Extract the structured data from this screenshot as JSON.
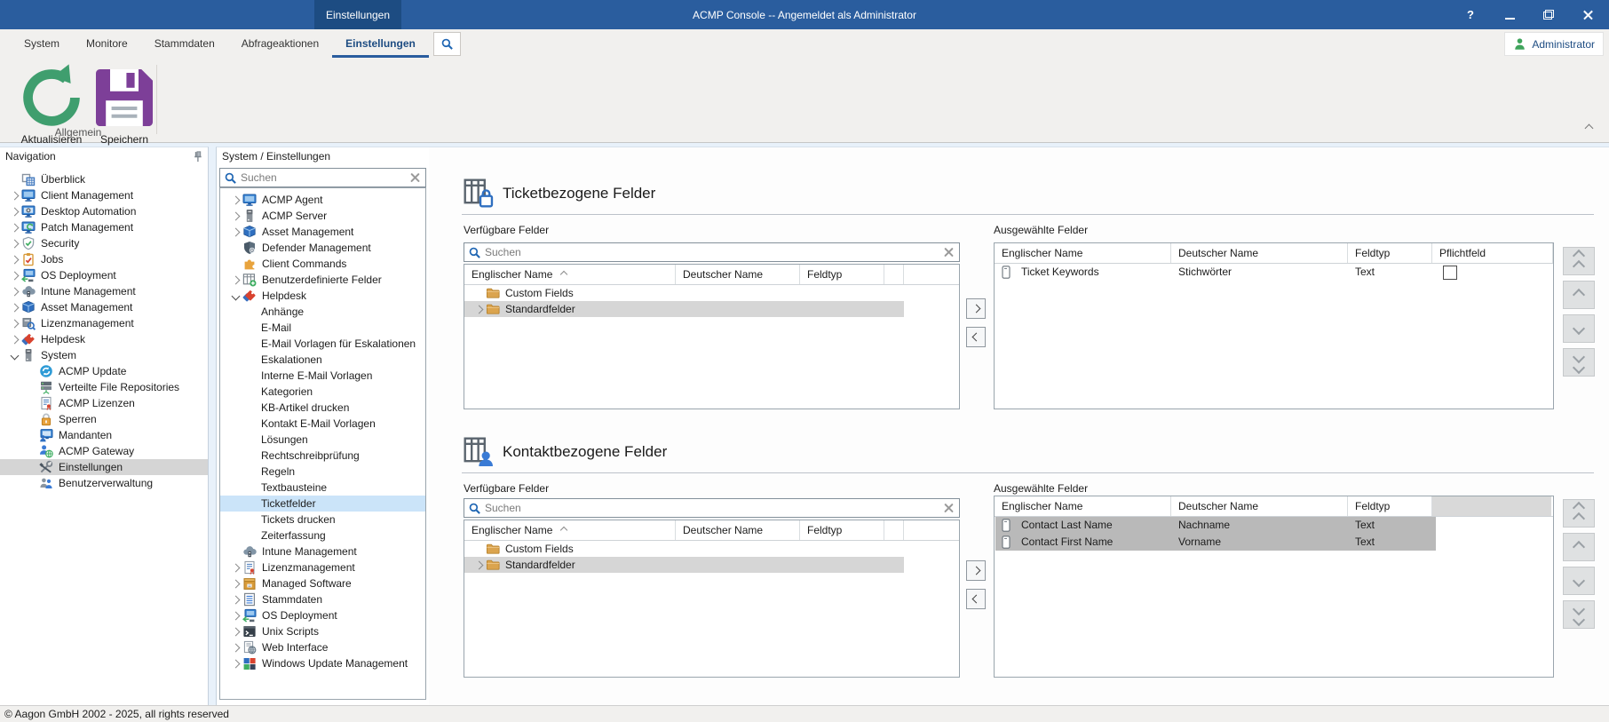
{
  "colors": {
    "titlebar_blue": "#2a5d9e",
    "titlebar_tab_blue": "#1d4c82",
    "accent_blue": "#2a5d9e",
    "tree_selection_blue": "#cbe4f9",
    "tree_selection_gray": "#d5d5d5",
    "row_selection_gray": "#b9b9b9",
    "folder_amber": "#dba44e",
    "refresh_green": "#3f9e6e",
    "save_purple": "#7d3f98",
    "admin_green": "#3fa45c"
  },
  "titlebar": {
    "context_tab": "Einstellungen",
    "title": "ACMP Console -- Angemeldet als Administrator",
    "help_glyph": "?"
  },
  "menubar": {
    "tabs": [
      "System",
      "Monitore",
      "Stammdaten",
      "Abfrageaktionen",
      "Einstellungen"
    ],
    "active_tab": "Einstellungen"
  },
  "ribbon": {
    "buttons": [
      {
        "label": "Aktualisieren",
        "icon": "refresh"
      },
      {
        "label": "Speichern",
        "icon": "save"
      }
    ],
    "group_label": "Allgemein"
  },
  "user_badge": {
    "label": "Administrator"
  },
  "nav_panel": {
    "header": "Navigation",
    "items": [
      {
        "label": "Überblick",
        "icon": "overview",
        "chevron": "none",
        "level": 0
      },
      {
        "label": "Client Management",
        "icon": "monitor",
        "chevron": "right",
        "level": 0
      },
      {
        "label": "Desktop Automation",
        "icon": "monitor-gear",
        "chevron": "right",
        "level": 0
      },
      {
        "label": "Patch Management",
        "icon": "monitor-refresh",
        "chevron": "right",
        "level": 0
      },
      {
        "label": "Security",
        "icon": "shield-check",
        "chevron": "right",
        "level": 0
      },
      {
        "label": "Jobs",
        "icon": "jobs",
        "chevron": "right",
        "level": 0
      },
      {
        "label": "OS Deployment",
        "icon": "os-deploy",
        "chevron": "right",
        "level": 0
      },
      {
        "label": "Intune Management",
        "icon": "cloud",
        "chevron": "right",
        "level": 0
      },
      {
        "label": "Asset Management",
        "icon": "package",
        "chevron": "right",
        "level": 0
      },
      {
        "label": "Lizenzmanagement",
        "icon": "license-search",
        "chevron": "right",
        "level": 0
      },
      {
        "label": "Helpdesk",
        "icon": "tag",
        "chevron": "right",
        "level": 0
      },
      {
        "label": "System",
        "icon": "server-tower",
        "chevron": "down",
        "level": 0
      },
      {
        "label": "ACMP Update",
        "icon": "update",
        "chevron": "none",
        "level": 1
      },
      {
        "label": "Verteilte File Repositories",
        "icon": "file-repos",
        "chevron": "none",
        "level": 1
      },
      {
        "label": "ACMP Lizenzen",
        "icon": "doc-seal",
        "chevron": "none",
        "level": 1
      },
      {
        "label": "Sperren",
        "icon": "lock",
        "chevron": "none",
        "level": 1
      },
      {
        "label": "Mandanten",
        "icon": "monitor-person",
        "chevron": "none",
        "level": 1
      },
      {
        "label": "ACMP Gateway",
        "icon": "gateway",
        "chevron": "none",
        "level": 1
      },
      {
        "label": "Einstellungen",
        "icon": "tools",
        "chevron": "none",
        "level": 1,
        "selected": true
      },
      {
        "label": "Benutzerverwaltung",
        "icon": "people",
        "chevron": "none",
        "level": 1
      }
    ]
  },
  "tree_panel": {
    "header": "System / Einstellungen",
    "search_placeholder": "Suchen",
    "items": [
      {
        "label": "ACMP Agent",
        "icon": "monitor",
        "chevron": "right",
        "level": 0
      },
      {
        "label": "ACMP Server",
        "icon": "server-tower",
        "chevron": "right",
        "level": 0
      },
      {
        "label": "Asset Management",
        "icon": "package",
        "chevron": "right",
        "level": 0
      },
      {
        "label": "Defender Management",
        "icon": "defender",
        "chevron": "none",
        "level": 0
      },
      {
        "label": "Client Commands",
        "icon": "puzzle",
        "chevron": "none",
        "level": 0
      },
      {
        "label": "Benutzerdefinierte Felder",
        "icon": "table-plus",
        "chevron": "right",
        "level": 0
      },
      {
        "label": "Helpdesk",
        "icon": "tag",
        "chevron": "down",
        "level": 0
      },
      {
        "label": "Anhänge",
        "icon": null,
        "chevron": "none",
        "level": 1
      },
      {
        "label": "E-Mail",
        "icon": null,
        "chevron": "none",
        "level": 1
      },
      {
        "label": "E-Mail Vorlagen für Eskalationen",
        "icon": null,
        "chevron": "none",
        "level": 1
      },
      {
        "label": "Eskalationen",
        "icon": null,
        "chevron": "none",
        "level": 1
      },
      {
        "label": "Interne E-Mail Vorlagen",
        "icon": null,
        "chevron": "none",
        "level": 1
      },
      {
        "label": "Kategorien",
        "icon": null,
        "chevron": "none",
        "level": 1
      },
      {
        "label": "KB-Artikel drucken",
        "icon": null,
        "chevron": "none",
        "level": 1
      },
      {
        "label": "Kontakt E-Mail Vorlagen",
        "icon": null,
        "chevron": "none",
        "level": 1
      },
      {
        "label": "Lösungen",
        "icon": null,
        "chevron": "none",
        "level": 1
      },
      {
        "label": "Rechtschreibprüfung",
        "icon": null,
        "chevron": "none",
        "level": 1
      },
      {
        "label": "Regeln",
        "icon": null,
        "chevron": "none",
        "level": 1
      },
      {
        "label": "Textbausteine",
        "icon": null,
        "chevron": "none",
        "level": 1
      },
      {
        "label": "Ticketfelder",
        "icon": null,
        "chevron": "none",
        "level": 1,
        "selected": true
      },
      {
        "label": "Tickets drucken",
        "icon": null,
        "chevron": "none",
        "level": 1
      },
      {
        "label": "Zeiterfassung",
        "icon": null,
        "chevron": "none",
        "level": 1
      },
      {
        "label": "Intune Management",
        "icon": "cloud",
        "chevron": "none",
        "level": 0
      },
      {
        "label": "Lizenzmanagement",
        "icon": "doc-seal",
        "chevron": "right",
        "level": 0
      },
      {
        "label": "Managed Software",
        "icon": "managed-box",
        "chevron": "right",
        "level": 0
      },
      {
        "label": "Stammdaten",
        "icon": "list",
        "chevron": "right",
        "level": 0
      },
      {
        "label": "OS Deployment",
        "icon": "os-deploy",
        "chevron": "right",
        "level": 0
      },
      {
        "label": "Unix Scripts",
        "icon": "terminal",
        "chevron": "right",
        "level": 0
      },
      {
        "label": "Web Interface",
        "icon": "web",
        "chevron": "right",
        "level": 0
      },
      {
        "label": "Windows Update Management",
        "icon": "windows",
        "chevron": "right",
        "level": 0
      }
    ]
  },
  "main": {
    "sections": [
      {
        "title": "Ticketbezogene Felder",
        "icon": "table-lock",
        "available_label": "Verfügbare Felder",
        "search_placeholder": "Suchen",
        "available_columns": [
          "Englischer Name",
          "Deutscher Name",
          "Feldtyp"
        ],
        "available_rows": [
          {
            "label": "Custom Fields",
            "expandable": false,
            "selected": false
          },
          {
            "label": "Standardfelder",
            "expandable": true,
            "selected": true
          }
        ],
        "selected_label": "Ausgewählte Felder",
        "selected_columns": [
          "Englischer Name",
          "Deutscher Name",
          "Feldtyp",
          "Pflichtfeld"
        ],
        "selected_rows": [
          {
            "english_name": "Ticket Keywords",
            "german_name": "Stichwörter",
            "field_type": "Text",
            "required": false,
            "selected": false
          }
        ]
      },
      {
        "title": "Kontaktbezogene Felder",
        "icon": "table-person",
        "available_label": "Verfügbare Felder",
        "search_placeholder": "Suchen",
        "available_columns": [
          "Englischer Name",
          "Deutscher Name",
          "Feldtyp"
        ],
        "available_rows": [
          {
            "label": "Custom Fields",
            "expandable": false,
            "selected": false
          },
          {
            "label": "Standardfelder",
            "expandable": true,
            "selected": true
          }
        ],
        "selected_label": "Ausgewählte Felder",
        "selected_columns": [
          "Englischer Name",
          "Deutscher Name",
          "Feldtyp"
        ],
        "selected_rows": [
          {
            "english_name": "Contact Last Name",
            "german_name": "Nachname",
            "field_type": "Text",
            "selected": true
          },
          {
            "english_name": "Contact First Name",
            "german_name": "Vorname",
            "field_type": "Text",
            "selected": true
          }
        ]
      }
    ]
  },
  "status_bar": {
    "text": "© Aagon GmbH 2002 - 2025, all rights reserved"
  }
}
